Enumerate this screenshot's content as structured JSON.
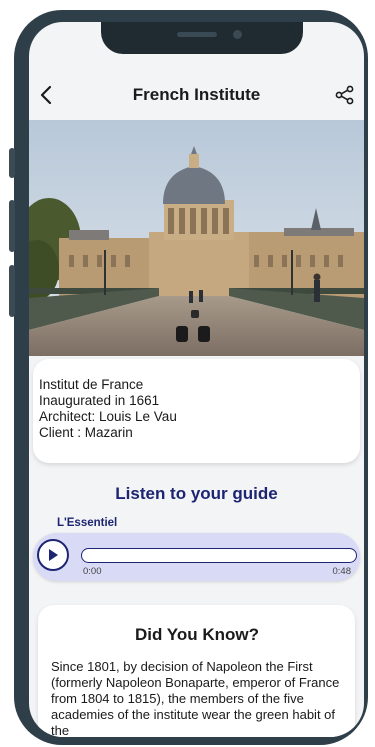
{
  "header": {
    "title": "French Institute",
    "back_icon": "chevron-left-icon",
    "share_icon": "share-icon"
  },
  "hero": {
    "image": "photo-institut-de-france"
  },
  "info": {
    "lines": [
      "Institut de France",
      "Inaugurated in 1661",
      "Architect: Louis Le Vau",
      "Client : Mazarin"
    ]
  },
  "audio": {
    "heading": "Listen to your guide",
    "track_name": "L'Essentiel",
    "current_time": "0:00",
    "total_time": "0:48",
    "progress": 0,
    "play_icon": "play-icon",
    "accent": "#1d2471"
  },
  "did_you_know": {
    "title": "Did You Know?",
    "body": "Since 1801, by decision of Napoleon the First (formerly Napoleon Bonaparte, emperor of France from 1804 to 1815), the members of the five academies of the institute wear the green habit of the"
  }
}
